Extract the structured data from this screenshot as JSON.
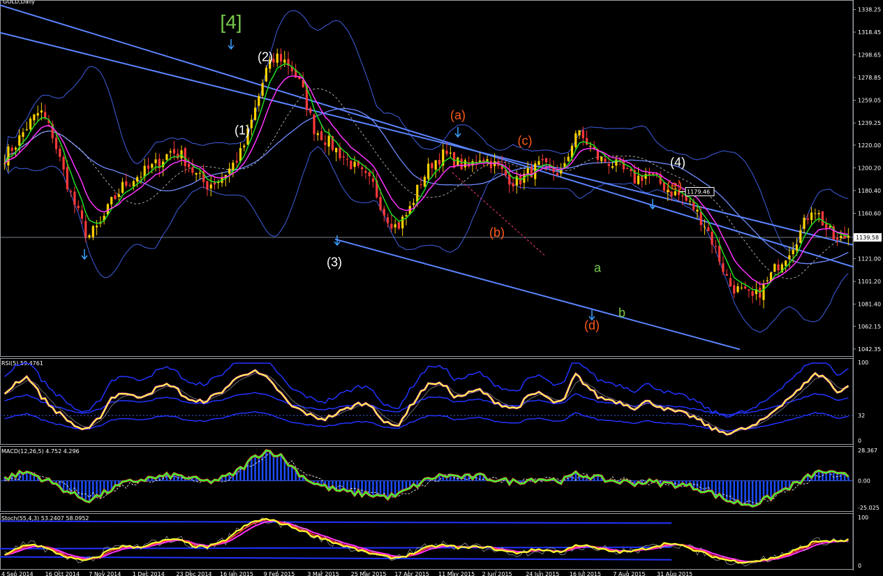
{
  "window": {
    "title": "GOLD,Daily"
  },
  "colors": {
    "background": "#000000",
    "bull_candle": "#ffd200",
    "bear_candle": "#ff3a3a",
    "channel": "#5b84ff",
    "bollinger": "#3f5fe0",
    "ma_fast": "#22dd22",
    "ma_slow": "#ff33ff",
    "rsi_line": "#ffff33",
    "macd_line": "#33ff33",
    "macd_hist": "#1a4dff",
    "wave_white": "#ffffff",
    "wave_orange": "#ff5a1a",
    "wave_green": "#77c84a"
  },
  "chart_data": [
    {
      "type": "candlestick",
      "title": "GOLD,Daily",
      "price_ticks": [
        "1338.25",
        "1318.45",
        "1298.65",
        "1278.85",
        "1259.05",
        "1239.25",
        "1220.00",
        "1200.20",
        "1180.40",
        "1160.60",
        "1140.80",
        "1121.00",
        "1101.20",
        "1081.40",
        "1062.15",
        "1042.35"
      ],
      "ylim": [
        1038,
        1344
      ],
      "current_price": "1139.58",
      "marked_price": "1179.46",
      "date_ticks": [
        "4 Sep 2014",
        "16 Oct 2014",
        "7 Nov 2014",
        "1 Dec 2014",
        "23 Dec 2014",
        "16 Jan 2015",
        "9 Feb 2015",
        "3 Mar 2015",
        "25 Mar 2015",
        "17 Apr 2015",
        "11 May 2015",
        "2 Jun 2015",
        "24 Jun 2015",
        "16 Jul 2015",
        "7 Aug 2015",
        "31 Aug 2015"
      ],
      "close_path": [
        1210,
        1222,
        1238,
        1250,
        1230,
        1195,
        1165,
        1140,
        1150,
        1170,
        1185,
        1192,
        1198,
        1205,
        1215,
        1210,
        1195,
        1185,
        1190,
        1200,
        1215,
        1248,
        1285,
        1298,
        1290,
        1270,
        1235,
        1225,
        1215,
        1205,
        1195,
        1185,
        1160,
        1148,
        1162,
        1188,
        1205,
        1212,
        1205,
        1200,
        1210,
        1205,
        1195,
        1187,
        1195,
        1202,
        1198,
        1195,
        1232,
        1222,
        1208,
        1205,
        1198,
        1190,
        1195,
        1188,
        1180,
        1175,
        1165,
        1150,
        1125,
        1098,
        1092,
        1086,
        1098,
        1115,
        1128,
        1145,
        1168,
        1150,
        1135,
        1142
      ],
      "wave_labels": [
        {
          "text": "[4]",
          "color": "green",
          "price": 1325
        },
        {
          "text": "(2)",
          "color": "white",
          "price": 1297
        },
        {
          "text": "(1)",
          "color": "white",
          "price": 1233
        },
        {
          "text": "(3)",
          "color": "white",
          "price": 1118
        },
        {
          "text": "(a)",
          "color": "orange",
          "price": 1246
        },
        {
          "text": "(b)",
          "color": "orange",
          "price": 1144
        },
        {
          "text": "(c)",
          "color": "orange",
          "price": 1224
        },
        {
          "text": "(d)",
          "color": "orange",
          "price": 1063
        },
        {
          "text": "(e)",
          "color": "orange",
          "price": 1185
        },
        {
          "text": "(4)",
          "color": "white",
          "price": 1205
        },
        {
          "text": "a",
          "color": "green",
          "price": 1113
        },
        {
          "text": "b",
          "color": "green",
          "price": 1074
        }
      ]
    },
    {
      "type": "line",
      "title": "RSI(5) 59.4761",
      "ticks": [
        "100",
        "32",
        "0"
      ],
      "ylim": [
        0,
        100
      ],
      "values": [
        60,
        75,
        82,
        58,
        42,
        30,
        18,
        12,
        30,
        55,
        62,
        55,
        60,
        68,
        72,
        58,
        48,
        52,
        60,
        72,
        86,
        88,
        80,
        65,
        45,
        38,
        30,
        28,
        35,
        42,
        48,
        44,
        22,
        18,
        40,
        62,
        75,
        70,
        55,
        60,
        65,
        52,
        45,
        40,
        55,
        62,
        50,
        48,
        85,
        70,
        55,
        52,
        48,
        42,
        50,
        45,
        38,
        35,
        30,
        20,
        12,
        10,
        14,
        18,
        28,
        42,
        55,
        66,
        85,
        82,
        62,
        70
      ]
    },
    {
      "type": "line",
      "title": "MACD(12,26,5) 4.752 4.296",
      "ticks": [
        "28.367",
        "0.00",
        "-25.025"
      ],
      "ylim": [
        -25.025,
        28.367
      ],
      "values": [
        2,
        6,
        8,
        3,
        -2,
        -8,
        -14,
        -18,
        -14,
        -8,
        -3,
        0,
        2,
        3,
        5,
        4,
        1,
        -1,
        1,
        5,
        12,
        22,
        28,
        25,
        15,
        5,
        -2,
        -6,
        -9,
        -11,
        -12,
        -13,
        -15,
        -14,
        -8,
        -2,
        3,
        5,
        4,
        3,
        4,
        2,
        0,
        -1,
        1,
        2,
        1,
        0,
        6,
        5,
        2,
        0,
        -1,
        -2,
        -1,
        -2,
        -3,
        -4,
        -6,
        -9,
        -14,
        -19,
        -21,
        -22,
        -18,
        -12,
        -6,
        -1,
        6,
        9,
        5,
        4.752
      ],
      "signal": [
        1,
        4,
        6,
        4,
        0,
        -5,
        -10,
        -14,
        -14,
        -10,
        -5,
        -2,
        1,
        2,
        4,
        4,
        2,
        0,
        0,
        3,
        9,
        17,
        24,
        24,
        18,
        10,
        3,
        -2,
        -6,
        -9,
        -11,
        -12,
        -14,
        -14,
        -10,
        -5,
        0,
        3,
        4,
        3,
        3,
        2,
        1,
        0,
        0,
        1,
        1,
        0,
        3,
        4,
        3,
        1,
        0,
        -1,
        -1,
        -1,
        -2,
        -3,
        -5,
        -7,
        -11,
        -16,
        -19,
        -21,
        -19,
        -15,
        -9,
        -4,
        2,
        6,
        5,
        4.296
      ]
    },
    {
      "type": "line",
      "title": "Stoch(55,4,3) 53.2407 58.0952",
      "ticks": [
        "100",
        "0"
      ],
      "ylim": [
        0,
        100
      ],
      "values": [
        20,
        35,
        45,
        40,
        30,
        20,
        12,
        10,
        20,
        35,
        40,
        38,
        42,
        48,
        55,
        50,
        40,
        38,
        45,
        60,
        78,
        92,
        96,
        90,
        82,
        72,
        62,
        55,
        45,
        38,
        30,
        24,
        18,
        16,
        22,
        32,
        40,
        42,
        38,
        36,
        40,
        36,
        30,
        26,
        30,
        34,
        30,
        28,
        44,
        40,
        34,
        30,
        28,
        30,
        36,
        42,
        48,
        40,
        32,
        24,
        16,
        10,
        8,
        9,
        12,
        18,
        26,
        36,
        48,
        52,
        50,
        53.24
      ]
    }
  ]
}
